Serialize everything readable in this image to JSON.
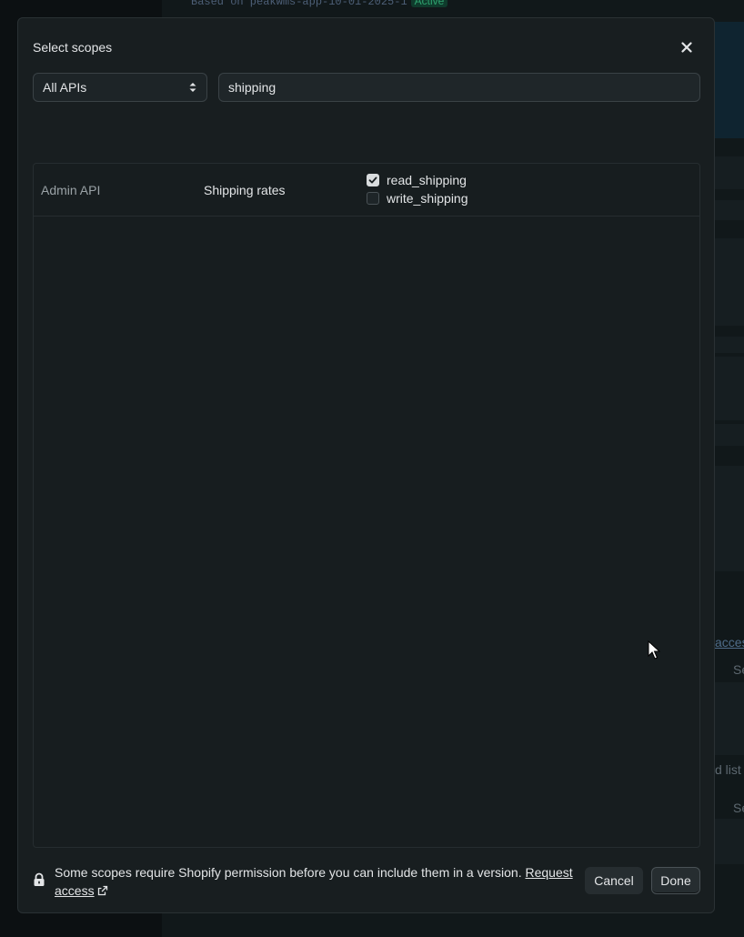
{
  "background": {
    "top_meta": "Based on peakwms-app-10-01-2025-1",
    "status_badge": "Active",
    "right_fragment_1": "acces",
    "right_fragment_2": "Se",
    "right_fragment_3": "d list",
    "right_fragment_4": "Se"
  },
  "modal": {
    "title": "Select scopes",
    "close_icon": "close-icon",
    "api_filter": {
      "selected": "All APIs",
      "icon": "select-arrows-icon"
    },
    "search": {
      "value": "shipping",
      "placeholder": ""
    },
    "rows": [
      {
        "api": "Admin API",
        "resource": "Shipping rates",
        "scopes": [
          {
            "name": "read_shipping",
            "checked": true
          },
          {
            "name": "write_shipping",
            "checked": false
          }
        ]
      }
    ],
    "footer": {
      "note": "Some scopes require Shopify permission before you can include them in a version.",
      "link_text": "Request access",
      "lock_icon": "lock-icon",
      "external_icon": "external-link-icon"
    },
    "buttons": {
      "cancel": "Cancel",
      "done": "Done"
    }
  },
  "colors": {
    "modal_bg": "#181e20",
    "text": "#e3e5e7",
    "muted_text": "#9aa2a6",
    "badge_green": "#2fa36f"
  }
}
